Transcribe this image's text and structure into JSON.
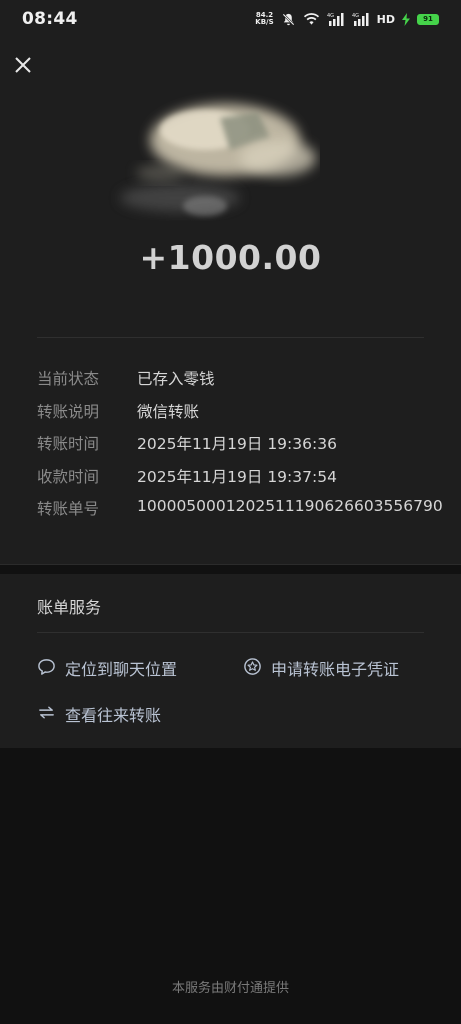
{
  "status_bar": {
    "time": "08:44",
    "net_speed_value": "84.2",
    "net_speed_unit": "KB/S",
    "hd_label": "HD",
    "battery_level": "91",
    "icons": [
      "mute-icon",
      "wifi-icon",
      "signal-4g-icon",
      "signal-4g-icon",
      "charging-icon",
      "battery-icon"
    ]
  },
  "transfer": {
    "close_icon": "close-icon",
    "amount": "+1000.00",
    "details": [
      {
        "label": "当前状态",
        "value": "已存入零钱"
      },
      {
        "label": "转账说明",
        "value": "微信转账"
      },
      {
        "label": "转账时间",
        "value": "2025年11月19日 19:36:36"
      },
      {
        "label": "收款时间",
        "value": "2025年11月19日 19:37:54"
      },
      {
        "label": "转账单号",
        "value": "1000050001202511190626603556790"
      }
    ]
  },
  "services": {
    "title": "账单服务",
    "items": [
      {
        "label": "定位到聊天位置",
        "icon": "chat-bubble-icon"
      },
      {
        "label": "申请转账电子凭证",
        "icon": "badge-star-icon"
      },
      {
        "label": "查看往来转账",
        "icon": "swap-arrows-icon"
      }
    ]
  },
  "footer": {
    "text": "本服务由财付通提供"
  },
  "colors": {
    "background": "#111111",
    "panel": "#1e1e1e",
    "link": "#b9c3d3",
    "label": "#8a8a8a",
    "battery": "#45d34a"
  }
}
